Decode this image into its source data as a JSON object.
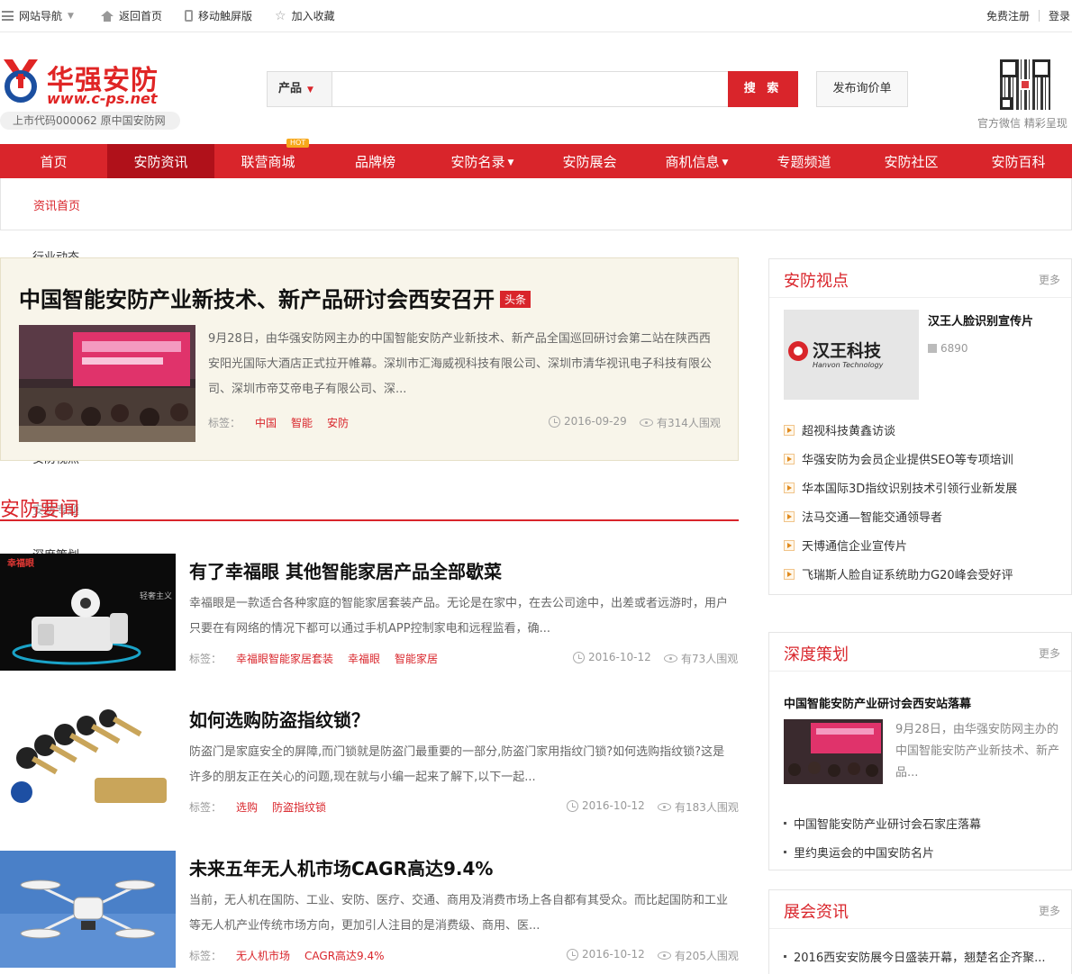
{
  "topbar": {
    "site_nav": "网站导航",
    "home": "返回首页",
    "mobile": "移动触屏版",
    "favorite": "加入收藏",
    "register": "免费注册",
    "login": "登录"
  },
  "brand": {
    "name_cn": "华强安防",
    "domain": "www.c-ps.net",
    "stock": "上市代码000062  原中国安防网",
    "brand_color": "#d9252b"
  },
  "search": {
    "category": "产品",
    "value": "",
    "button": "搜 索",
    "publish": "发布询价单"
  },
  "wechat": {
    "caption": "官方微信 精彩呈现"
  },
  "nav": {
    "hot_badge": "HOT",
    "items": [
      "首页",
      "安防资讯",
      "联营商城",
      "品牌榜",
      "安防名录",
      "安防展会",
      "商机信息",
      "专题频道",
      "安防社区",
      "安防百科"
    ]
  },
  "subnav": {
    "active": "资讯首页",
    "overlapped": [
      "行业动态",
      "安防视点",
      "安防专题",
      "深度策划"
    ]
  },
  "feature": {
    "title": "中国智能安防产业新技术、新产品研讨会西安召开",
    "badge": "头条",
    "desc": "9月28日，由华强安防网主办的中国智能安防产业新技术、新产品全国巡回研讨会第二站在陕西西安阳光国际大酒店正式拉开帷幕。深圳市汇海威视科技有限公司、深圳市清华视讯电子科技有限公司、深圳市帝艾帝电子有限公司、深...",
    "tags_label": "标签：",
    "tags": [
      "中国",
      "智能",
      "安防"
    ],
    "date": "2016-09-29",
    "views": "有314人围观"
  },
  "news": {
    "title": "安防要闻",
    "articles": [
      {
        "title": "有了幸福眼 其他智能家居产品全部歇菜",
        "desc": "幸福眼是一款适合各种家庭的智能家居套装产品。无论是在家中，在去公司途中，出差或者远游时，用户只要在有网络的情况下都可以通过手机APP控制家电和远程监看，确...",
        "tags_label": "标签：",
        "tags": [
          "幸福眼智能家居套装",
          "幸福眼",
          "智能家居"
        ],
        "date": "2016-10-12",
        "views": "有73人围观"
      },
      {
        "title": "如何选购防盗指纹锁？",
        "desc": "防盗门是家庭安全的屏障,而门锁就是防盗门最重要的一部分,防盗门家用指纹门锁?如何选购指纹锁?这是许多的朋友正在关心的问题,现在就与小编一起来了解下,以下一起...",
        "tags_label": "标签：",
        "tags": [
          "选购",
          "防盗指纹锁"
        ],
        "date": "2016-10-12",
        "views": "有183人围观"
      },
      {
        "title": "未来五年无人机市场CAGR高达9.4%",
        "desc": "当前，无人机在国防、工业、安防、医疗、交通、商用及消费市场上各自都有其受众。而比起国防和工业等无人机产业传统市场方向，更加引人注目的是消费级、商用、医...",
        "tags_label": "标签：",
        "tags": [
          "无人机市场",
          "CAGR高达9.4%"
        ],
        "date": "2016-10-12",
        "views": "有205人围观"
      }
    ]
  },
  "viewpoint": {
    "title": "安防视点",
    "more": "更多",
    "video_title": "汉王人脸识别宣传片",
    "video_views": "6890",
    "logo_text": "汉王科技",
    "logo_en": "Hanvon Technology",
    "items": [
      "超视科技黄鑫访谈",
      "华强安防为会员企业提供SEO等专项培训",
      "华本国际3D指纹识别技术引领行业新发展",
      "法马交通—智能交通领导者",
      "天博通信企业宣传片",
      "飞瑞斯人脸自证系统助力G20峰会受好评"
    ]
  },
  "depth": {
    "title": "深度策划",
    "more": "更多",
    "headline": "中国智能安防产业研讨会西安站落幕",
    "desc": "9月28日，由华强安防网主办的中国智能安防产业新技术、新产品...",
    "items": [
      "中国智能安防产业研讨会石家庄落幕",
      "里约奥运会的中国安防名片"
    ]
  },
  "expo": {
    "title": "展会资讯",
    "more": "更多",
    "items": [
      "2016西安安防展今日盛装开幕，翘楚名企齐聚..."
    ]
  }
}
